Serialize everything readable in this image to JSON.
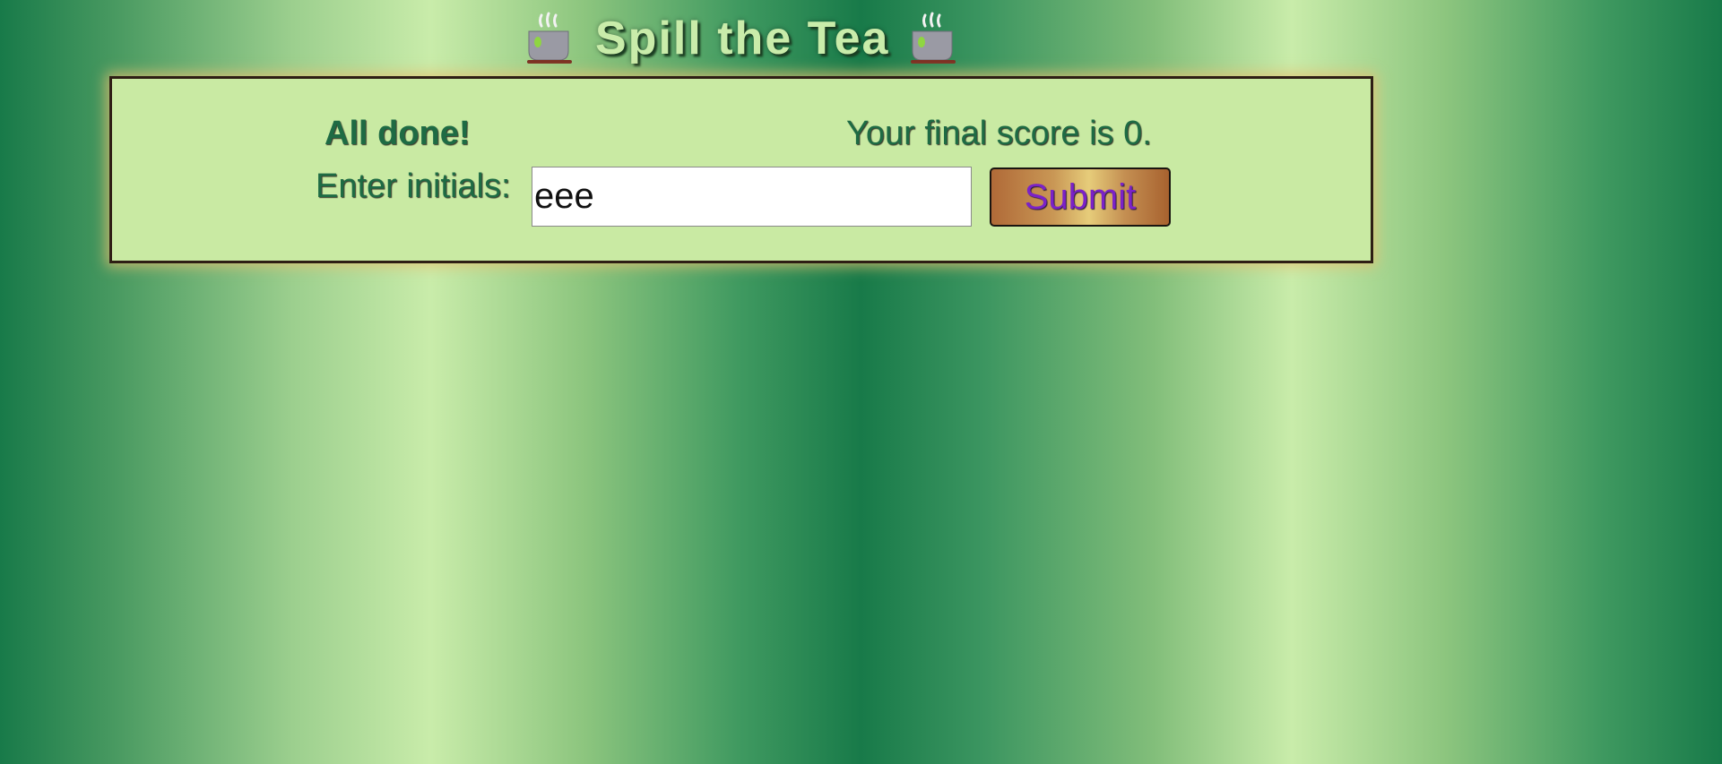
{
  "header": {
    "title": "Spill the Tea",
    "left_icon": "tea-cup-icon",
    "right_icon": "tea-cup-icon"
  },
  "results": {
    "heading": "All done!",
    "score_text": "Your final score is 0.",
    "initials_label": "Enter initials:",
    "initials_value": "eee",
    "submit_label": "Submit"
  },
  "colors": {
    "panel_background": "#c9eaa3",
    "text_green": "#1e6b44",
    "title_green": "#c9ecaa",
    "submit_text": "#7b22c8"
  }
}
